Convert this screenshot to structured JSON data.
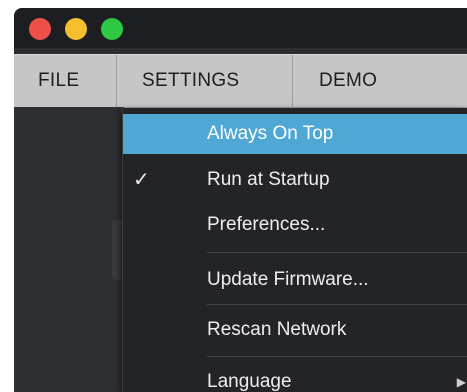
{
  "menubar": {
    "file_label": "FILE",
    "settings_label": "SETTINGS",
    "demo_label": "DEMO"
  },
  "settings_menu": {
    "items": [
      {
        "label": "Always On Top",
        "checked": false,
        "highlighted": true
      },
      {
        "label": "Run at Startup",
        "checked": true,
        "check_glyph": "✓"
      },
      {
        "label": "Preferences..."
      },
      {
        "label": "Update Firmware..."
      },
      {
        "label": "Rescan Network"
      },
      {
        "label": "Language",
        "submenu": true,
        "arrow_glyph": "▶"
      }
    ]
  },
  "colors": {
    "highlight": "#4fa7d3",
    "menubar": "#c6c6c6",
    "dropdown_bg": "#232427",
    "close": "#f0504a",
    "minimize": "#f5bf2e",
    "zoom": "#2ec844"
  }
}
